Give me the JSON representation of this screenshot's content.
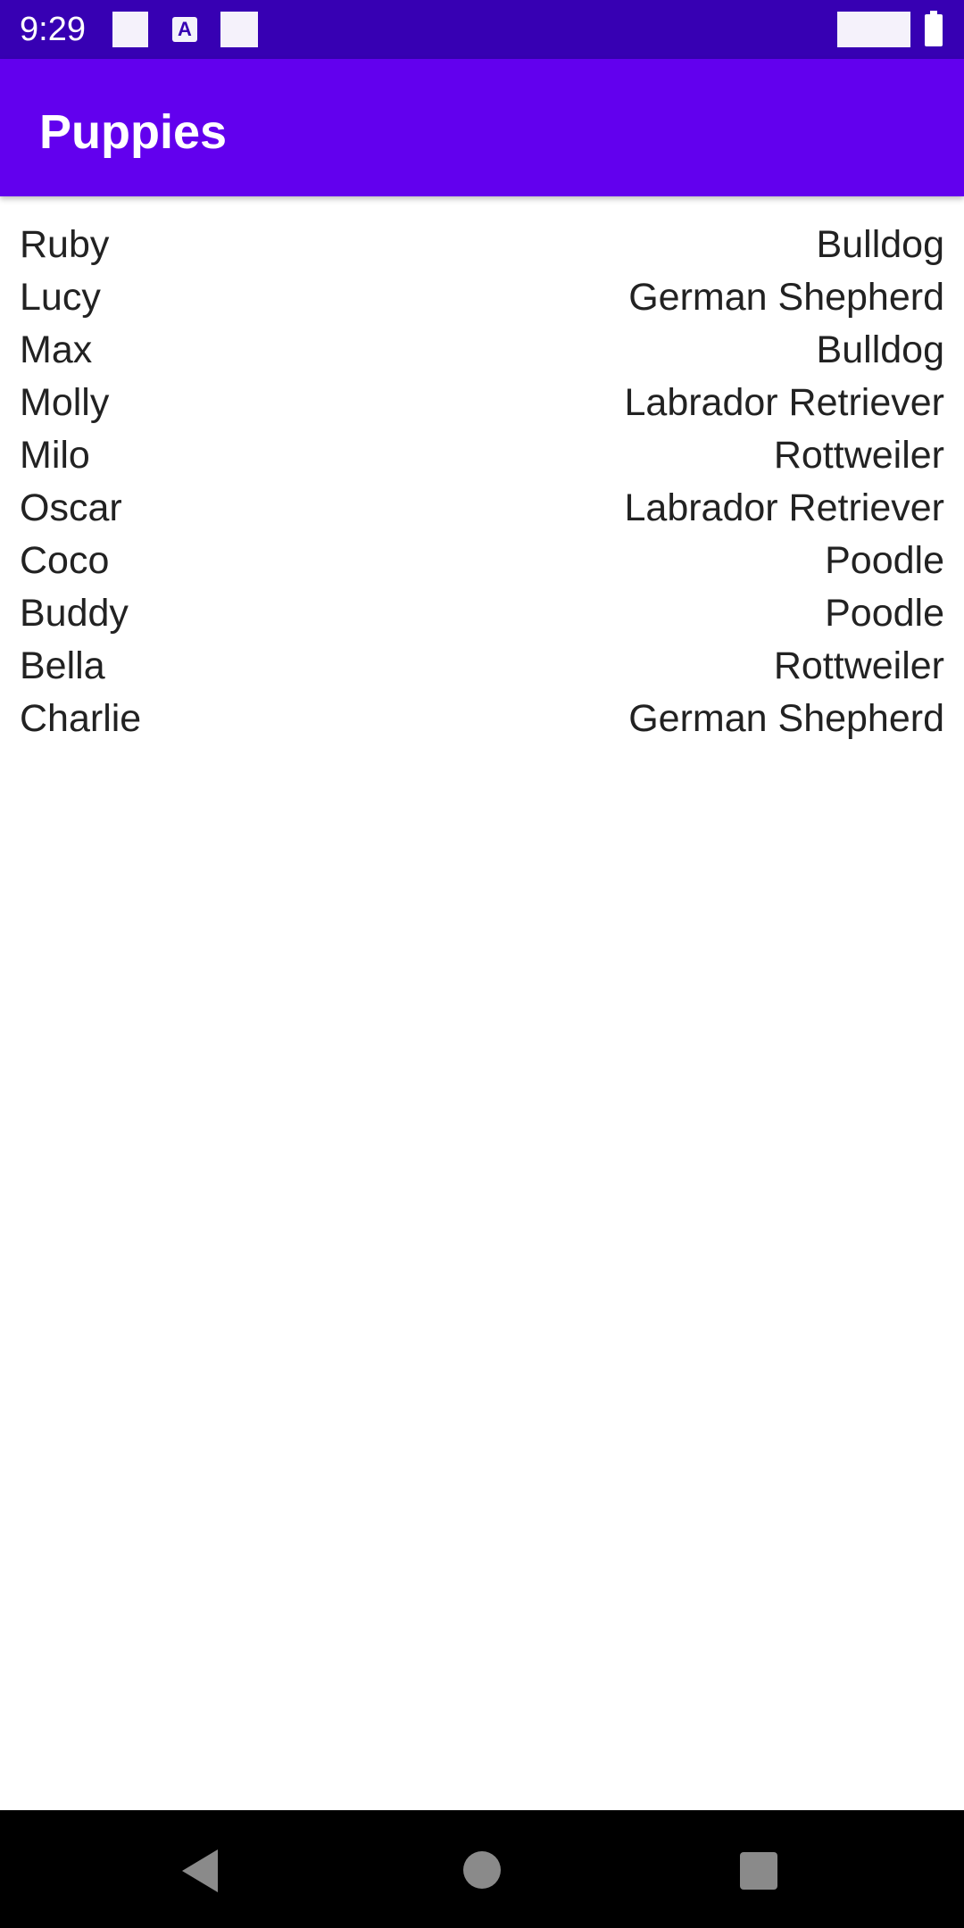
{
  "status_bar": {
    "time": "9:29",
    "icons": [
      "notification-icon",
      "text-a-icon",
      "notification-icon",
      "signal-icon",
      "battery-icon"
    ],
    "text_icon_label": "A"
  },
  "app_bar": {
    "title": "Puppies",
    "color": "#6200ee"
  },
  "colors": {
    "status_bar": "#3700b3",
    "app_bar": "#6200ee",
    "nav_bar": "#000000"
  },
  "puppies": [
    {
      "name": "Ruby",
      "breed": "Bulldog"
    },
    {
      "name": "Lucy",
      "breed": "German Shepherd"
    },
    {
      "name": "Max",
      "breed": "Bulldog"
    },
    {
      "name": "Molly",
      "breed": "Labrador Retriever"
    },
    {
      "name": "Milo",
      "breed": "Rottweiler"
    },
    {
      "name": "Oscar",
      "breed": "Labrador Retriever"
    },
    {
      "name": "Coco",
      "breed": "Poodle"
    },
    {
      "name": "Buddy",
      "breed": "Poodle"
    },
    {
      "name": "Bella",
      "breed": "Rottweiler"
    },
    {
      "name": "Charlie",
      "breed": "German Shepherd"
    }
  ],
  "nav_bar": {
    "buttons": [
      "back-icon",
      "home-icon",
      "recents-icon"
    ]
  }
}
